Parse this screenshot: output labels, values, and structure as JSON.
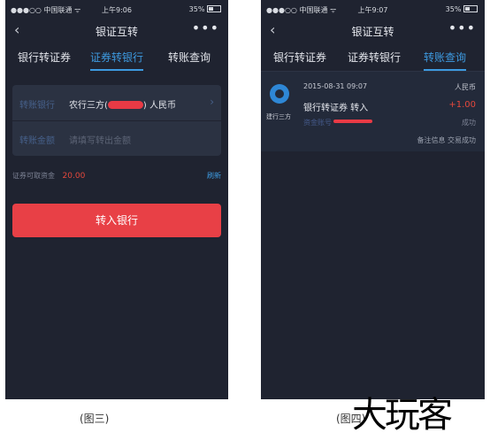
{
  "statusbar": {
    "carrier": "●●●○○ 中国联通 ᯤ",
    "time_left": "上午9:06",
    "time_right": "上午9:07",
    "battery": "35%"
  },
  "nav": {
    "back_icon": "‹",
    "title": "银证互转",
    "more_icon": "•••"
  },
  "tabs": [
    "银行转证券",
    "证券转银行",
    "转账查询"
  ],
  "screen3": {
    "active_tab": 1,
    "bank_label": "转账银行",
    "bank_value_prefix": "农行三方(",
    "bank_value_suffix": ") 人民币",
    "amount_label": "转账金额",
    "amount_placeholder": "请填写转出金额",
    "available_label": "证券可取资金",
    "available_amount": "20.00",
    "refresh": "刷新",
    "submit": "转入银行"
  },
  "screen4": {
    "active_tab": 2,
    "record": {
      "logo_label": "建行三方",
      "datetime": "2015-08-31 09:07",
      "currency": "人民币",
      "type": "银行转证券  转入",
      "amount": "+1.00",
      "account_prefix": "资金账号",
      "status": "成功",
      "note": "备注信息 交易成功"
    }
  },
  "captions": {
    "left": "(图三)",
    "right": "(图四)"
  },
  "watermark": "大玩客",
  "colors": {
    "accent": "#3d9ae0",
    "danger": "#e84046",
    "bg": "#1f2330"
  }
}
